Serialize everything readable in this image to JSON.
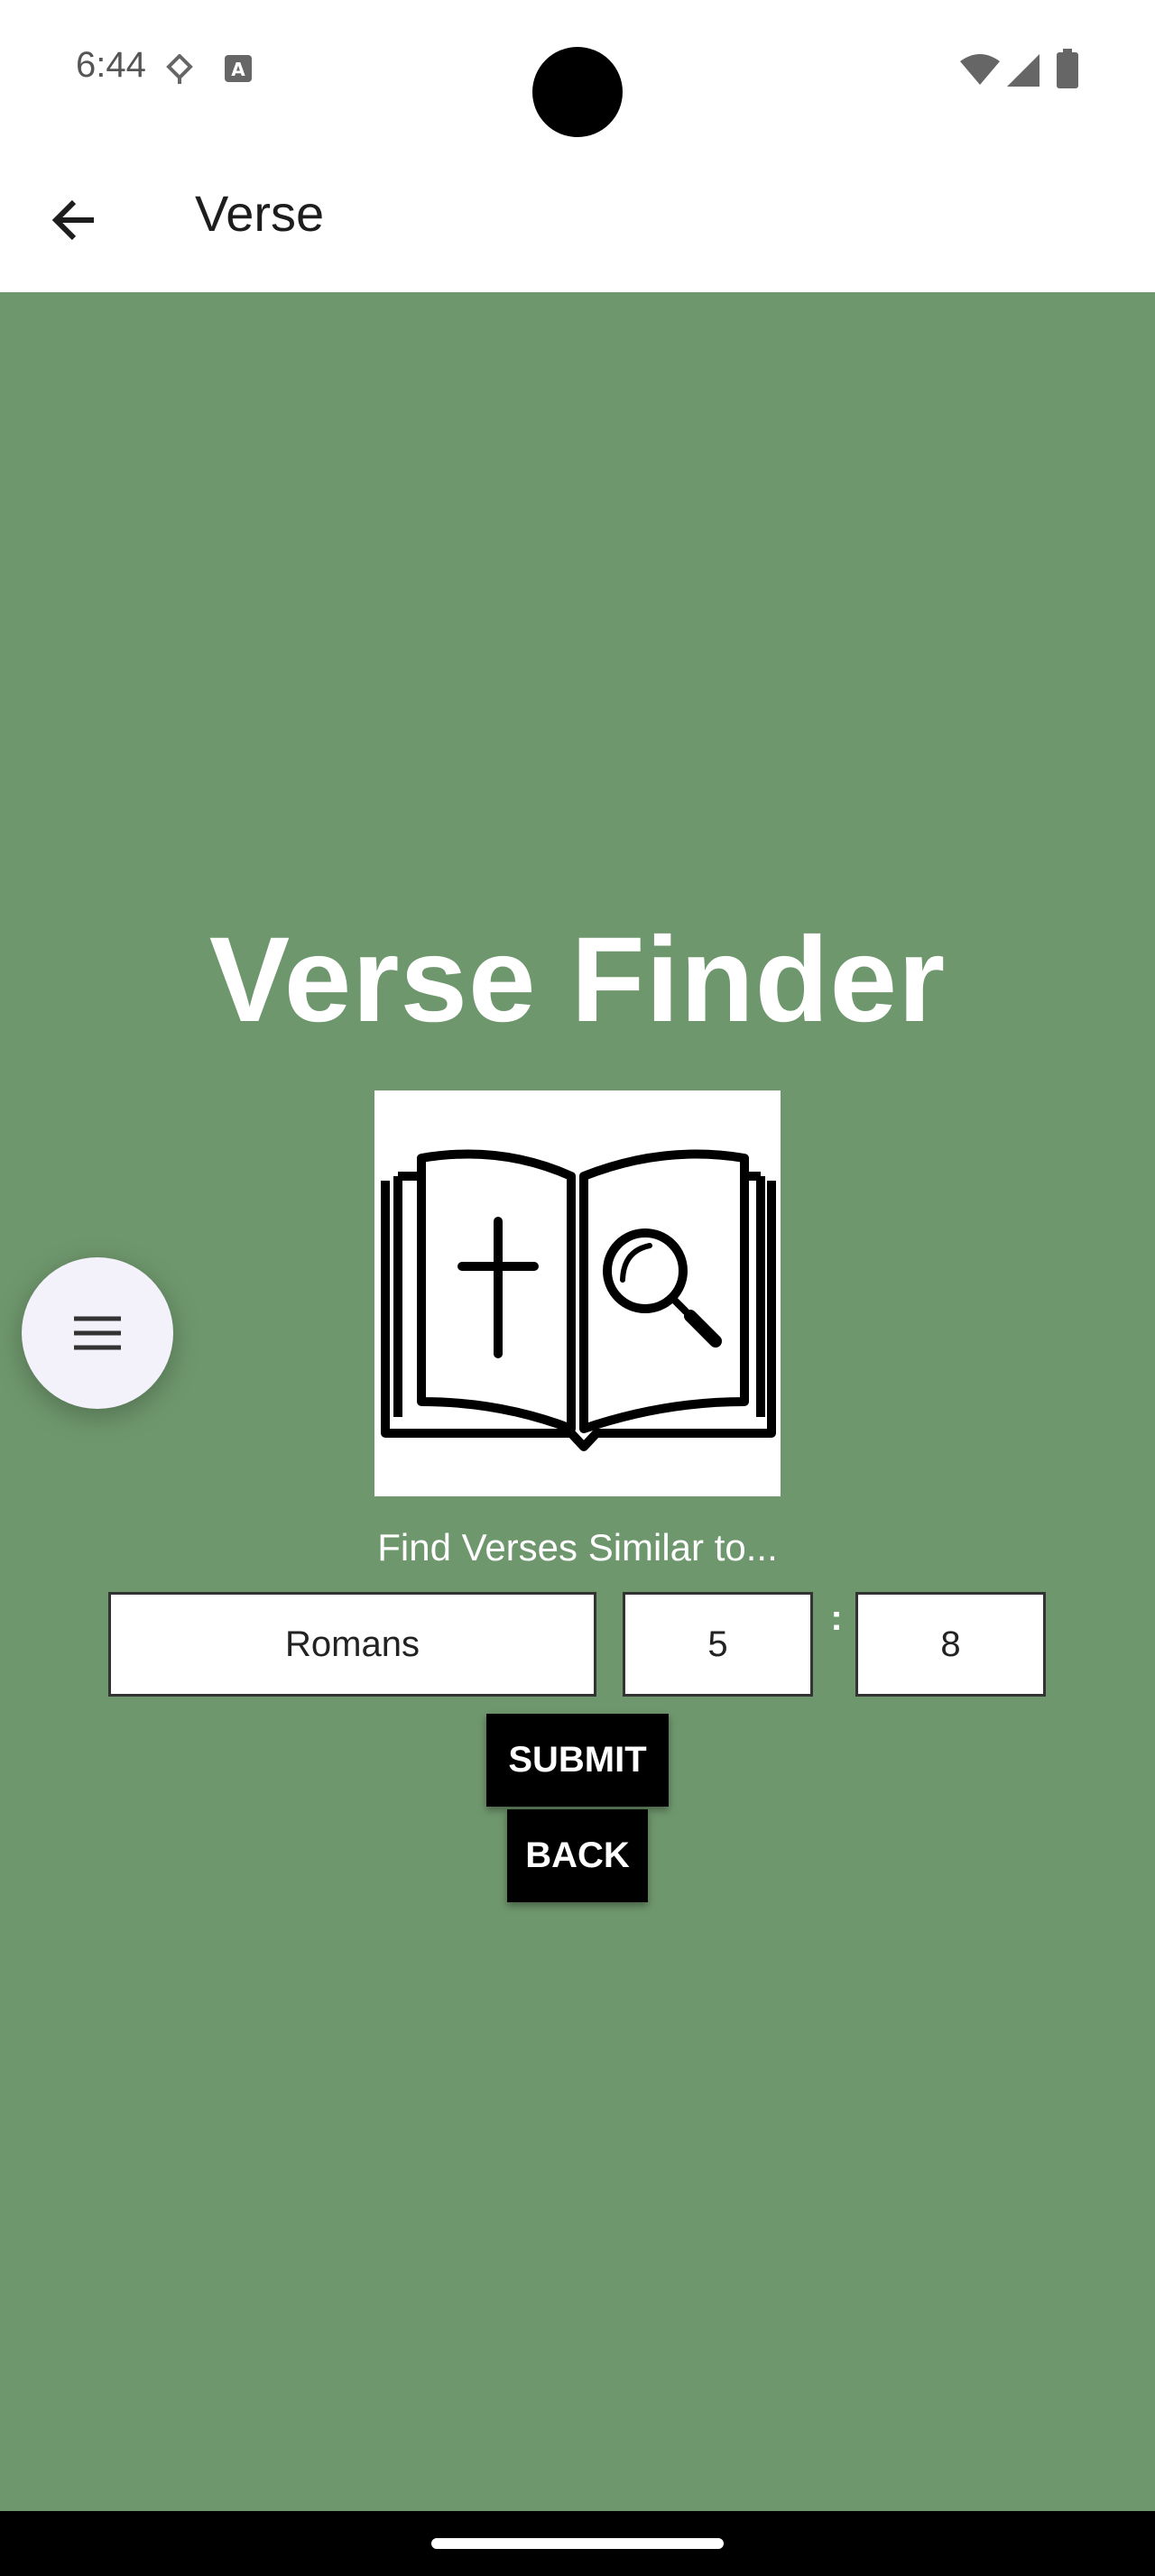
{
  "status_bar": {
    "time": "6:44",
    "icons": [
      "data-saver-icon",
      "keyboard-a-icon",
      "wifi-icon",
      "signal-icon",
      "battery-icon"
    ]
  },
  "app_bar": {
    "title": "Verse",
    "back_icon": "arrow-back-icon"
  },
  "main": {
    "title": "Verse Finder",
    "logo_icon": "open-bible-cross-magnifier-icon",
    "subtitle": "Find Verses Similar to...",
    "book_value": "Romans",
    "chapter_value": "5",
    "separator": ":",
    "verse_value": "8",
    "submit_label": "SUBMIT",
    "back_label": "BACK"
  },
  "fab": {
    "icon": "menu-icon"
  },
  "colors": {
    "background": "#6f976d",
    "button": "#000000",
    "fab": "#f3f1fa"
  }
}
